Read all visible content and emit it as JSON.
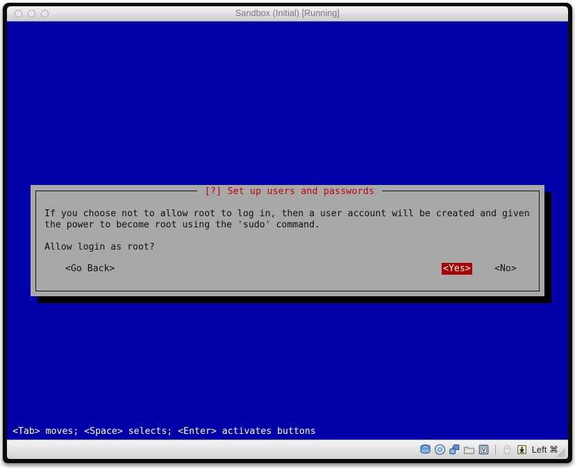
{
  "window": {
    "title": "Sandbox (Initial) [Running]",
    "traffic_lights": [
      "close",
      "minimize",
      "zoom"
    ]
  },
  "console": {
    "background_color": "#0000a8",
    "hint_line": "<Tab> moves; <Space> selects; <Enter> activates buttons"
  },
  "dialog": {
    "title": "[?] Set up users and passwords",
    "title_color": "#c00000",
    "background_color": "#a8a8a8",
    "body_lines": [
      "If you choose not to allow root to log in, then a user account will be created and given",
      "the power to become root using the 'sudo' command.",
      "",
      "Allow login as root?"
    ],
    "buttons": [
      {
        "label": "<Go Back>",
        "selected": false
      },
      {
        "label": "<Yes>",
        "selected": true
      },
      {
        "label": "<No>",
        "selected": false
      }
    ],
    "selected_highlight_color": "#aa0000"
  },
  "statusbar": {
    "icons": [
      "hard-disk-icon",
      "optical-disk-icon",
      "network-icon",
      "shared-folder-icon",
      "virtualization-icon",
      "mouse-integration-icon",
      "host-key-icon"
    ],
    "host_key_label": "Left ⌘"
  }
}
